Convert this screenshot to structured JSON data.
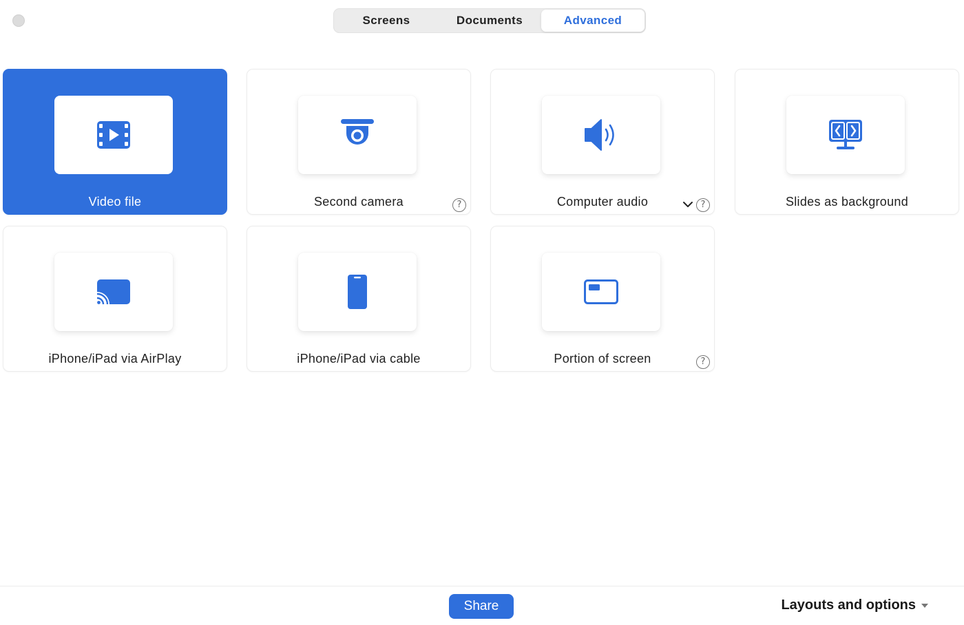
{
  "tabs": [
    {
      "label": "Screens",
      "active": false
    },
    {
      "label": "Documents",
      "active": false
    },
    {
      "label": "Advanced",
      "active": true
    }
  ],
  "options": [
    {
      "label": "Video file",
      "icon": "video-file-icon",
      "selected": true,
      "help": false,
      "dropdown": false
    },
    {
      "label": "Second camera",
      "icon": "camera-icon",
      "selected": false,
      "help": true,
      "dropdown": false
    },
    {
      "label": "Computer audio",
      "icon": "speaker-icon",
      "selected": false,
      "help": true,
      "dropdown": true
    },
    {
      "label": "Slides as background",
      "icon": "slides-monitor-icon",
      "selected": false,
      "help": false,
      "dropdown": false
    },
    {
      "label": "iPhone/iPad via AirPlay",
      "icon": "airplay-icon",
      "selected": false,
      "help": false,
      "dropdown": false
    },
    {
      "label": "iPhone/iPad via cable",
      "icon": "phone-icon",
      "selected": false,
      "help": false,
      "dropdown": false
    },
    {
      "label": "Portion of screen",
      "icon": "portion-screen-icon",
      "selected": false,
      "help": true,
      "dropdown": false
    }
  ],
  "help_glyph": "?",
  "footer": {
    "share_label": "Share",
    "layouts_label": "Layouts and options"
  },
  "colors": {
    "accent": "#2f6fdc",
    "background": "#ffffff"
  }
}
